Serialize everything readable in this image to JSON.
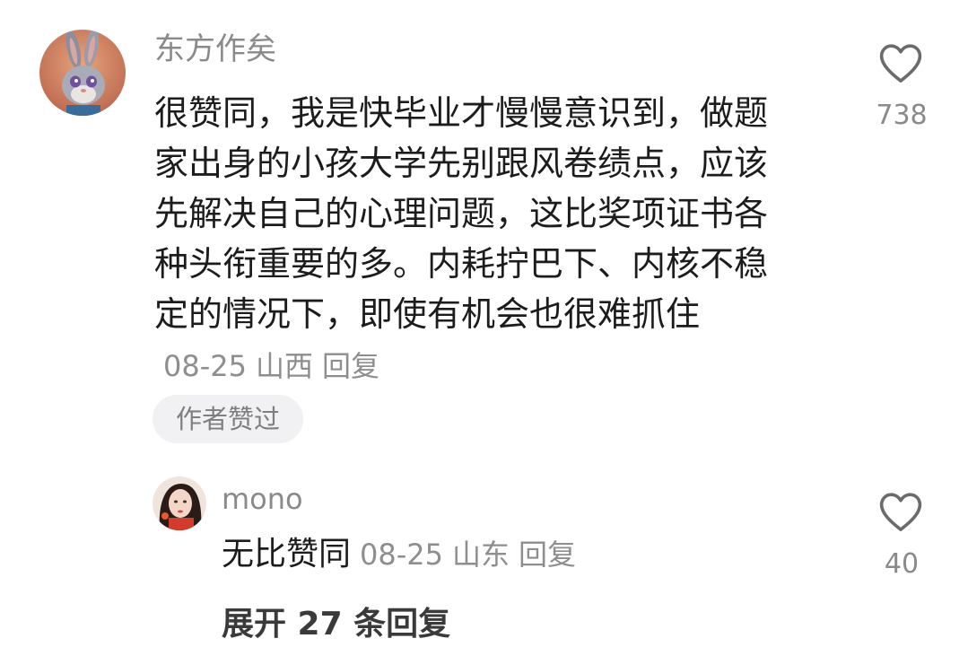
{
  "comment": {
    "username": "东方作矣",
    "text": "很赞同，我是快毕业才慢慢意识到，做题家出身的小孩大学先别跟风卷绩点，应该先解决自己的心理问题，这比奖项证书各种头衔重要的多。内耗拧巴下、内核不稳定的情况下，即使有机会也很难抓住",
    "date": "08-25",
    "location": "山西",
    "reply_label": "回复",
    "author_liked_label": "作者赞过",
    "like_count": "738",
    "like_icon": "heart-outline-icon"
  },
  "reply": {
    "username": "mono",
    "text": "无比赞同",
    "date": "08-25",
    "location": "山东",
    "reply_label": "回复",
    "like_count": "40",
    "like_icon": "heart-outline-icon"
  },
  "expand_replies_label": "展开 27 条回复"
}
